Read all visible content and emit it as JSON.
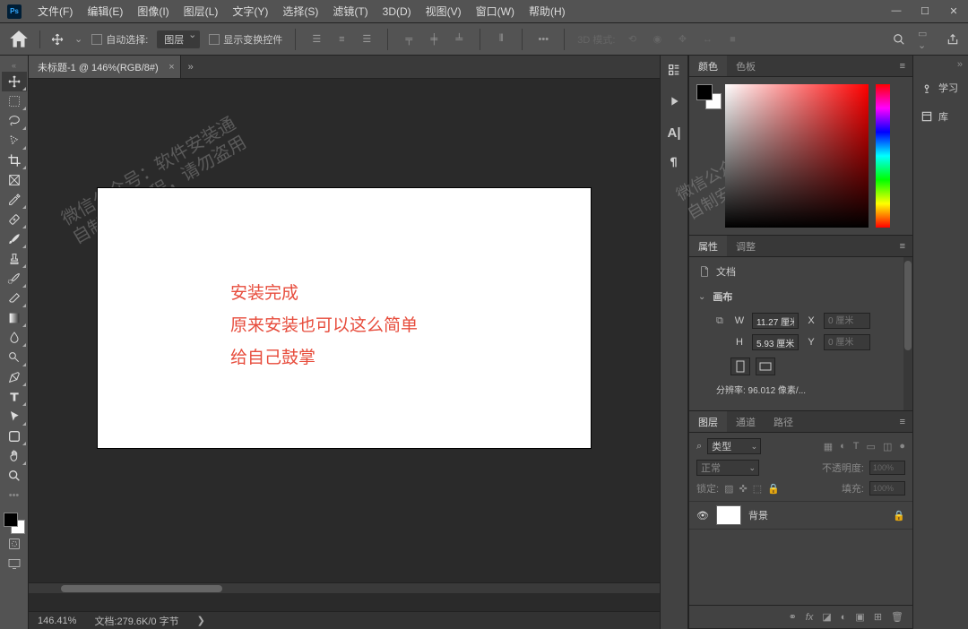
{
  "menu": [
    "文件(F)",
    "编辑(E)",
    "图像(I)",
    "图层(L)",
    "文字(Y)",
    "选择(S)",
    "滤镜(T)",
    "3D(D)",
    "视图(V)",
    "窗口(W)",
    "帮助(H)"
  ],
  "options": {
    "autoSelect": "自动选择:",
    "autoSelectValue": "图层",
    "showTransform": "显示变换控件",
    "mode3d": "3D 模式:"
  },
  "tab": {
    "title": "未标题-1 @ 146%(RGB/8#)"
  },
  "canvasText": [
    "安装完成",
    "原来安装也可以这么简单",
    "给自己鼓掌"
  ],
  "status": {
    "zoom": "146.41%",
    "doc": "文档:279.6K/0 字节"
  },
  "panels": {
    "color": {
      "tabs": [
        "颜色",
        "色板"
      ]
    },
    "props": {
      "tabs": [
        "属性",
        "调整"
      ],
      "docLabel": "文档",
      "canvasLabel": "画布",
      "w": "11.27 厘米",
      "h": "5.93 厘米",
      "wPh": "0 厘米",
      "hPh": "0 厘米",
      "res": "分辨率: 96.012 像素/..."
    },
    "layers": {
      "tabs": [
        "图层",
        "通道",
        "路径"
      ],
      "type": "类型",
      "blend": "正常",
      "opacityLabel": "不透明度:",
      "opacity": "100%",
      "lockLabel": "锁定:",
      "fillLabel": "填充:",
      "fill": "100%",
      "bgLayer": "背景"
    }
  },
  "rightbar": {
    "learn": "学习",
    "lib": "库"
  },
  "search": {
    "ph": "搜索"
  },
  "watermark": {
    "l1a": "微信公众号：软件安装通",
    "l1b": "自制安装教程，请勿盗用"
  }
}
